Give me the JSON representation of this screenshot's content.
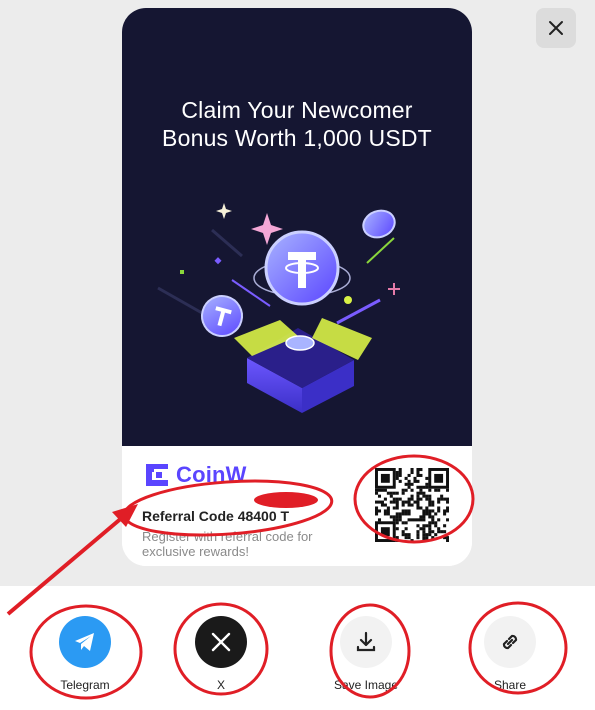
{
  "poster": {
    "headline_line1": "Claim Your Newcomer",
    "headline_line2": "Bonus Worth 1,000 USDT",
    "brand_name": "CoinW",
    "referral_code": "Referral Code 48400 T",
    "referral_desc": "Register with referral code for exclusive rewards!"
  },
  "share": {
    "items": [
      {
        "label": "Telegram",
        "icon": "telegram-icon",
        "color": "#2b9af3"
      },
      {
        "label": "X",
        "icon": "x-icon",
        "color": "#1a1a1a"
      },
      {
        "label": "Save Image",
        "icon": "download-icon",
        "color": "#f2f2f2"
      },
      {
        "label": "Share",
        "icon": "link-icon",
        "color": "#f2f2f2"
      }
    ]
  },
  "colors": {
    "poster_bg": "#151632",
    "brand": "#5a45ff",
    "annotation": "#e01e26",
    "page_bg": "#ececec"
  }
}
